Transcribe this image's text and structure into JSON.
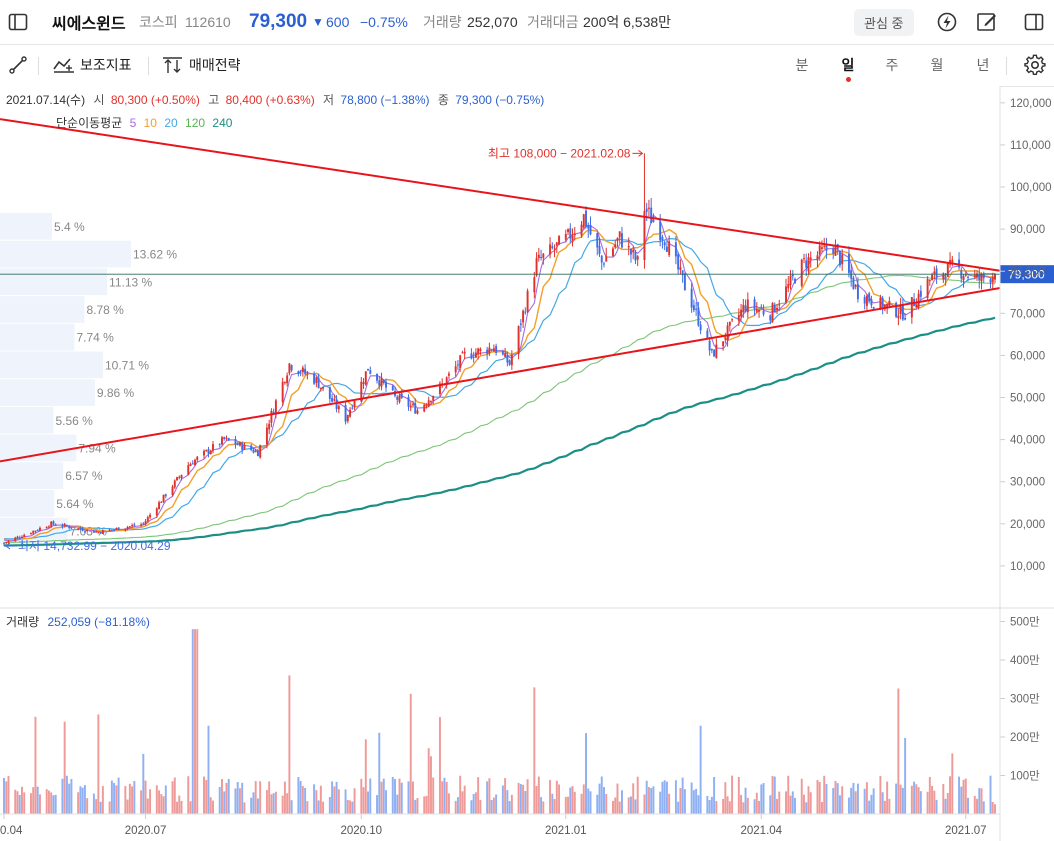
{
  "header": {
    "name": "씨에스윈드",
    "market": "코스피",
    "code": "112610",
    "price": "79,300",
    "change_symbol": "▼",
    "change": "600",
    "change_pct": "−0.75%",
    "volume_label": "거래량",
    "volume": "252,070",
    "amount_label": "거래대금",
    "amount": "200억 6,538만",
    "watch_button": "관심 중",
    "icons": [
      "sidebar-toggle-icon",
      "lightning-icon",
      "edit-icon",
      "panel-icon"
    ]
  },
  "toolbar": {
    "draw_icon": "pen-line-icon",
    "indicator_label": "보조지표",
    "strategy_label": "매매전략",
    "periods": [
      "분",
      "일",
      "주",
      "월",
      "년"
    ],
    "active_period": "일",
    "settings_icon": "gear-icon"
  },
  "info": {
    "date": "2021.07.14(수)",
    "open_label": "시",
    "open": "80,300 (+0.50%)",
    "high_label": "고",
    "high": "80,400 (+0.63%)",
    "low_label": "저",
    "low": "78,800 (−1.38%)",
    "close_label": "종",
    "close": "79,300 (−0.75%)",
    "ma_label": "단순이동평균",
    "ma_periods": [
      "5",
      "10",
      "20",
      "120",
      "240"
    ]
  },
  "annotations": {
    "high": "최고 108,000 − 2021.02.08",
    "low": "최저 14,732.99 − 2020.04.29",
    "price_tag": "79,300"
  },
  "volume_info": {
    "label": "거래량",
    "value": "252,059 (−81.18%)"
  },
  "colors": {
    "up": "#e0312b",
    "down": "#3f6ee4",
    "vol_up": "#ee9a98",
    "vol_down": "#8fb0f2",
    "ma5": "#a56ee0",
    "ma10": "#f2a02b",
    "ma20": "#44a8e8",
    "ma120": "#7cc577",
    "ma240": "#1b8f86",
    "trendline": "#e8141c",
    "price_line": "#2d6b5a",
    "price_tag": "#2b5fcf"
  },
  "chart_data": {
    "type": "candlestick",
    "y_ticks": [
      "120,000",
      "110,000",
      "100,000",
      "90,000",
      "80,000",
      "70,000",
      "60,000",
      "50,000",
      "40,000",
      "30,000",
      "20,000",
      "10,000"
    ],
    "ylim": [
      0,
      124000
    ],
    "volume_ticks": [
      "500만",
      "400만",
      "300만",
      "200만",
      "100만"
    ],
    "volume_ylim": [
      0,
      5350000
    ],
    "x_ticks": [
      {
        "label": "0.04",
        "date": "2020-04-29"
      },
      {
        "label": "2020.07",
        "date": "2020-07-01"
      },
      {
        "label": "2020.10",
        "date": "2020-10-05"
      },
      {
        "label": "2021.01",
        "date": "2021-01-04"
      },
      {
        "label": "2021.04",
        "date": "2021-04-01"
      },
      {
        "label": "2021.07",
        "date": "2021-07-01"
      }
    ],
    "x_range": [
      "2020-04-29",
      "2021-07-14"
    ],
    "key_points": [
      {
        "date": "2020-04-29",
        "close": 15500
      },
      {
        "date": "2020-05-20",
        "close": 20000
      },
      {
        "date": "2020-06-10",
        "close": 18000
      },
      {
        "date": "2020-06-30",
        "close": 20000
      },
      {
        "date": "2020-07-20",
        "close": 34000
      },
      {
        "date": "2020-08-05",
        "close": 40000
      },
      {
        "date": "2020-08-20",
        "close": 37000
      },
      {
        "date": "2020-09-03",
        "close": 58000
      },
      {
        "date": "2020-09-15",
        "close": 54000
      },
      {
        "date": "2020-09-28",
        "close": 45000
      },
      {
        "date": "2020-10-08",
        "close": 57000
      },
      {
        "date": "2020-10-20",
        "close": 50000
      },
      {
        "date": "2020-10-30",
        "close": 47000
      },
      {
        "date": "2020-11-10",
        "close": 53000
      },
      {
        "date": "2020-11-20",
        "close": 60000
      },
      {
        "date": "2020-12-03",
        "close": 62000
      },
      {
        "date": "2020-12-10",
        "close": 58000
      },
      {
        "date": "2020-12-22",
        "close": 82000
      },
      {
        "date": "2021-01-05",
        "close": 88000
      },
      {
        "date": "2021-01-12",
        "close": 93000
      },
      {
        "date": "2021-01-20",
        "close": 82000
      },
      {
        "date": "2021-01-28",
        "close": 88000
      },
      {
        "date": "2021-02-05",
        "close": 82000
      },
      {
        "date": "2021-02-08",
        "close": 95000
      },
      {
        "date": "2021-02-17",
        "close": 88000
      },
      {
        "date": "2021-03-03",
        "close": 70000
      },
      {
        "date": "2021-03-10",
        "close": 60000
      },
      {
        "date": "2021-03-25",
        "close": 72000
      },
      {
        "date": "2021-04-05",
        "close": 70000
      },
      {
        "date": "2021-04-20",
        "close": 82000
      },
      {
        "date": "2021-05-03",
        "close": 86000
      },
      {
        "date": "2021-05-14",
        "close": 75000
      },
      {
        "date": "2021-05-24",
        "close": 72000
      },
      {
        "date": "2021-06-04",
        "close": 70000
      },
      {
        "date": "2021-06-15",
        "close": 78000
      },
      {
        "date": "2021-06-25",
        "close": 81000
      },
      {
        "date": "2021-07-07",
        "close": 78000
      },
      {
        "date": "2021-07-14",
        "close": 79300
      }
    ],
    "moving_averages": [
      "5",
      "10",
      "20",
      "120",
      "240"
    ],
    "high_marker": {
      "date": "2021-02-08",
      "value": 108000
    },
    "low_marker": {
      "date": "2020-04-29",
      "value": 14732.99
    },
    "last_close": 79300,
    "volume_profile": [
      {
        "label": "5.4 %",
        "value": 5.4
      },
      {
        "label": "13.62 %",
        "value": 13.62
      },
      {
        "label": "11.13 %",
        "value": 11.13
      },
      {
        "label": "8.78 %",
        "value": 8.78
      },
      {
        "label": "7.74 %",
        "value": 7.74
      },
      {
        "label": "10.71 %",
        "value": 10.71
      },
      {
        "label": "9.86 %",
        "value": 9.86
      },
      {
        "label": "5.56 %",
        "value": 5.56
      },
      {
        "label": "7.94 %",
        "value": 7.94
      },
      {
        "label": "6.57 %",
        "value": 6.57
      },
      {
        "label": "5.64 %",
        "value": 5.64
      },
      {
        "label": "7.03 %",
        "value": 7.03
      }
    ],
    "trendlines": [
      {
        "from": {
          "date": "2020-04-29",
          "value": 116000
        },
        "to": {
          "date": "2021-07-14",
          "value": 80300
        }
      },
      {
        "from": {
          "date": "2020-04-29",
          "value": 35000
        },
        "to": {
          "date": "2021-07-14",
          "value": 75800
        }
      }
    ]
  }
}
